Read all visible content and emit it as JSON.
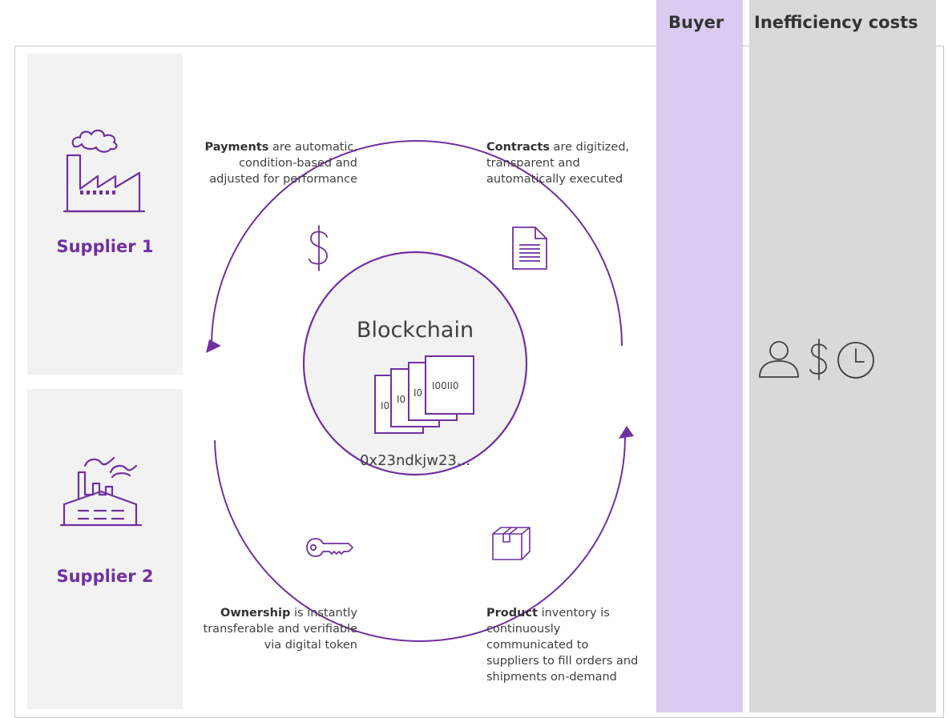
{
  "header": {
    "buyer": "Buyer",
    "inefficiency": "Inefficiency costs"
  },
  "suppliers": [
    {
      "label": "Supplier 1",
      "icon": "factory-smoke-icon"
    },
    {
      "label": "Supplier 2",
      "icon": "factory-chimneys-icon"
    }
  ],
  "center": {
    "title": "Blockchain",
    "blocks": [
      "I0",
      "I0",
      "I0",
      "I00II0"
    ],
    "hash": "0x23ndkjw23..."
  },
  "captions": {
    "payments": {
      "bold": "Payments",
      "line1_rest": " are automatic,",
      "line2": "condition-based and",
      "line3": "adjusted for performance"
    },
    "contracts": {
      "bold": "Contracts",
      "line1_rest": " are digitized,",
      "line2": "transparent and",
      "line3": "automatically executed"
    },
    "ownership": {
      "bold": "Ownership",
      "line1_rest": " is instantly",
      "line2": "transferable and verifiable",
      "line3": "via digital token"
    },
    "product": {
      "bold": "Product",
      "line1_rest": " inventory is",
      "line2": "continuously",
      "line3": "communicated to",
      "line4": "suppliers to fill orders and",
      "line5": "shipments on-demand"
    }
  },
  "icons": {
    "payments": "dollar-icon",
    "contracts": "document-icon",
    "ownership": "key-icon",
    "product": "box-icon",
    "inefficiency": [
      "person-icon",
      "dollar-icon",
      "clock-icon"
    ]
  },
  "colors": {
    "accent": "#7030a0",
    "buyer_column": "#dccbf0",
    "inefficiency_column": "#d9d9d9",
    "supplier_box": "#f2f2f2",
    "center_circle": "#f2f2f2"
  }
}
